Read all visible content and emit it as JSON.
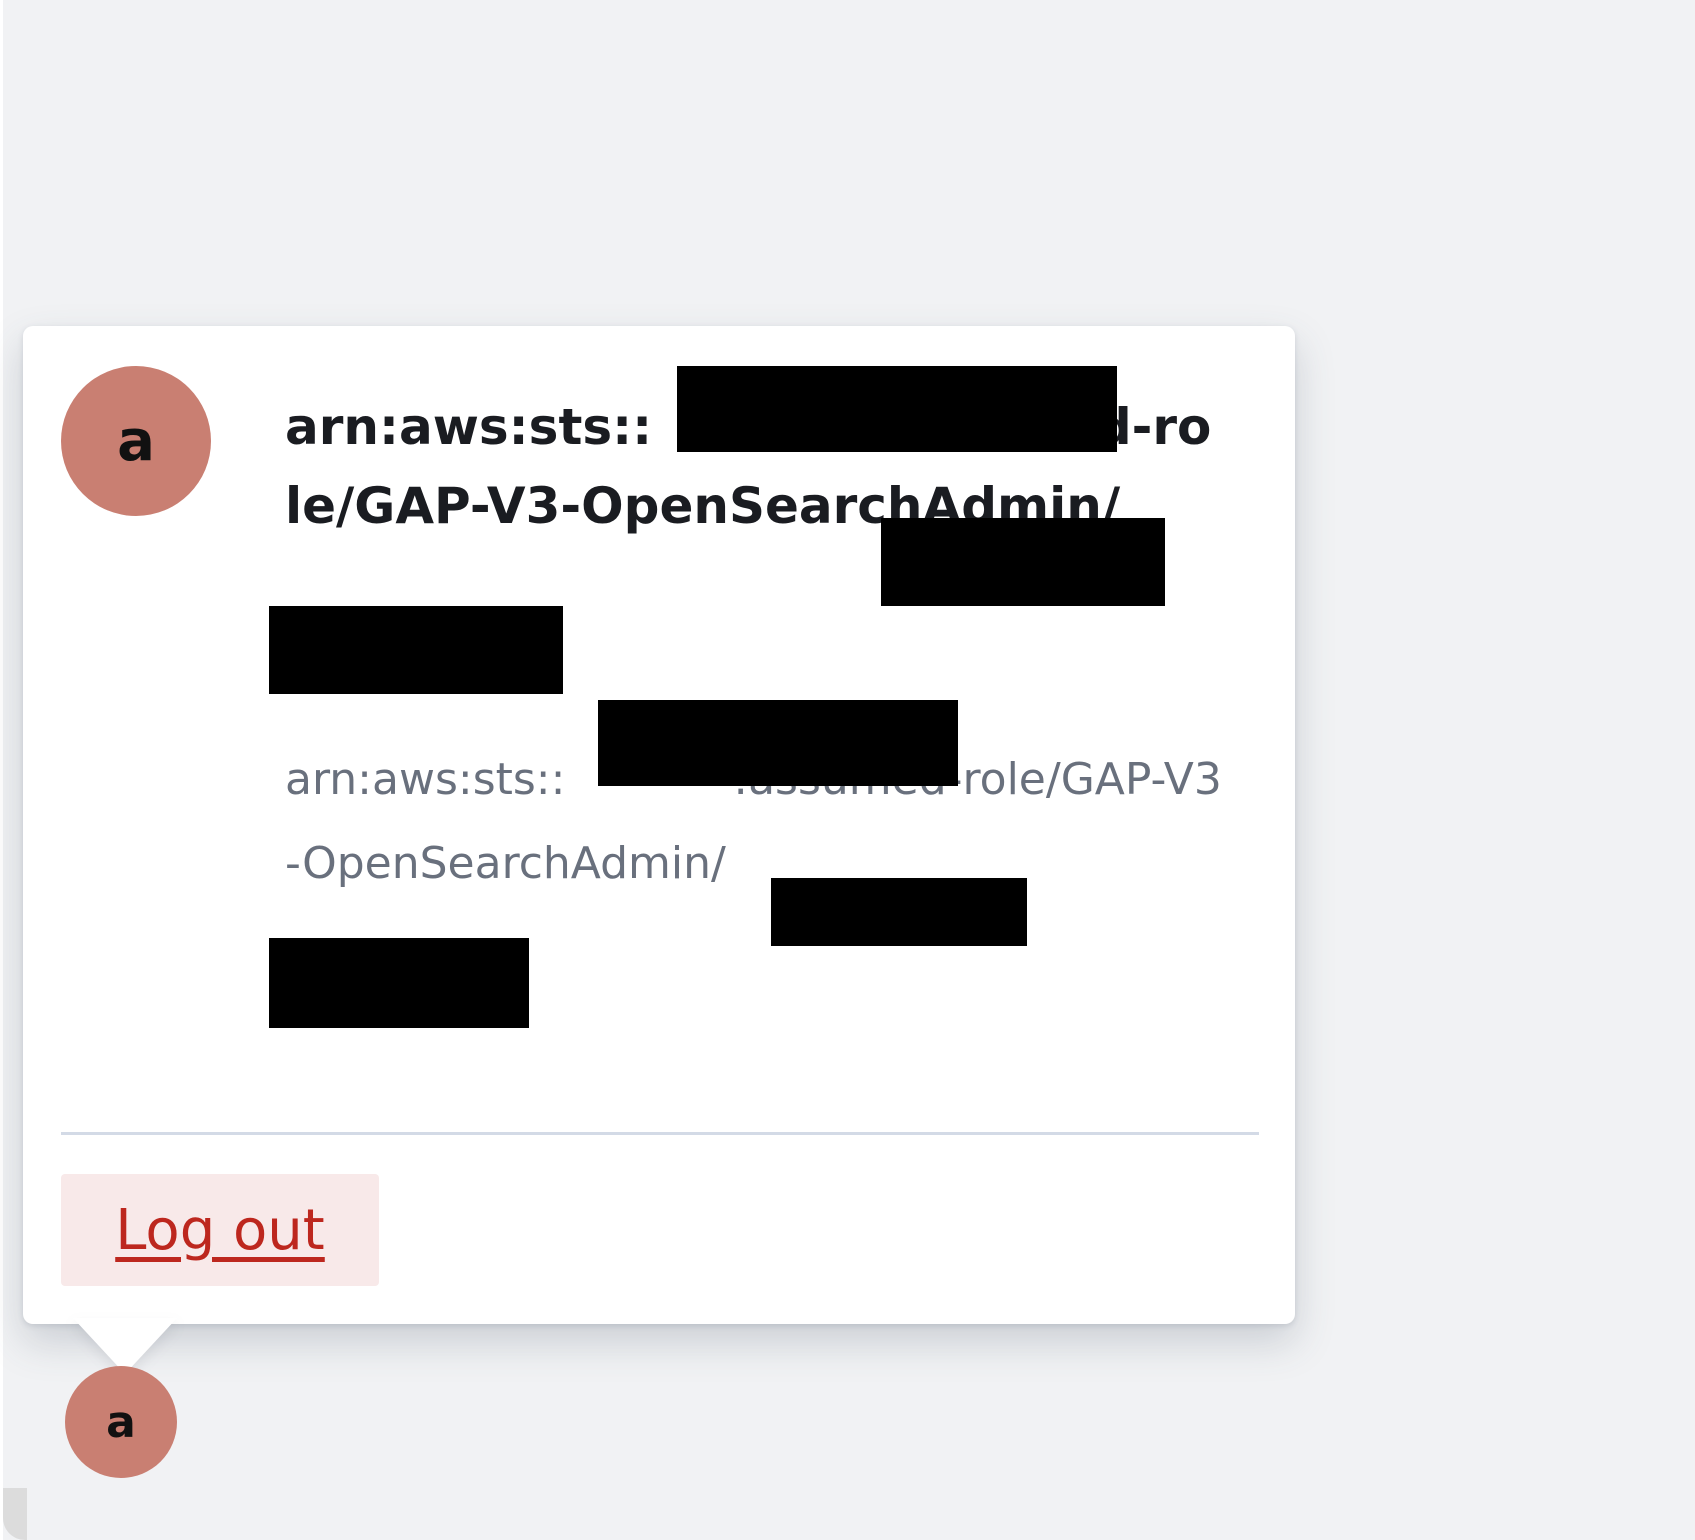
{
  "user_popover": {
    "avatar_initial": "a",
    "display_name": "arn:aws:sts::            :assumed-role/GAP-V3-OpenSearchAdmin/",
    "username": "arn:aws:sts::            :assumed-role/GAP-V3-OpenSearchAdmin/",
    "logout_label": "Log out"
  },
  "header_user_menu": {
    "avatar_initial": "a"
  },
  "colors": {
    "avatar": "#c97f72",
    "logout_text": "#bd271e",
    "logout_background": "#f8e9e9",
    "page_background": "#f1f2f4"
  }
}
